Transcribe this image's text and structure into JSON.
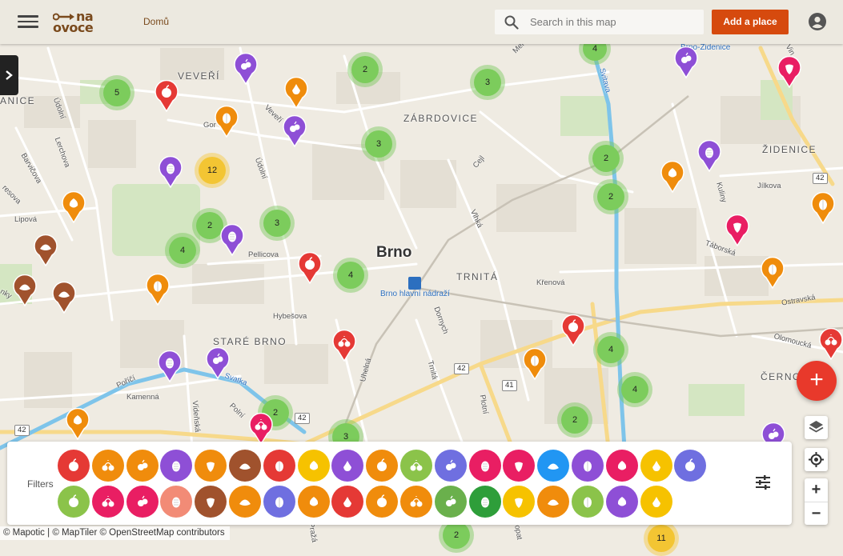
{
  "header": {
    "logo_line1": "na",
    "logo_line2": "ovoce",
    "home_label": "Domů",
    "search_placeholder": "Search in this map",
    "add_place_label": "Add a place"
  },
  "map": {
    "city_label": "Brno",
    "station_label": "Brno hlavní nádraží",
    "district_labels": [
      {
        "text": "VEVEŘÍ"
      },
      {
        "text": "ZÁBRDOVICE"
      },
      {
        "text": "ŽIDENICE"
      },
      {
        "text": "TRNITÁ"
      },
      {
        "text": "STARÉ BRNO"
      },
      {
        "text": "ČERNO"
      },
      {
        "text": "ANICE"
      }
    ],
    "street_labels": [
      {
        "text": "Údolní"
      },
      {
        "text": "Lerchova"
      },
      {
        "text": "Barvičova"
      },
      {
        "text": "Lipová"
      },
      {
        "text": "Veveří"
      },
      {
        "text": "Údolní"
      },
      {
        "text": "Pellicova"
      },
      {
        "text": "Hybešova"
      },
      {
        "text": "Kamenná"
      },
      {
        "text": "Poříčí"
      },
      {
        "text": "Vídeňská"
      },
      {
        "text": "Polní"
      },
      {
        "text": "Uhelná"
      },
      {
        "text": "Dornych"
      },
      {
        "text": "Trnitá"
      },
      {
        "text": "Plotní"
      },
      {
        "text": "Vlhká"
      },
      {
        "text": "Cejl"
      },
      {
        "text": "Křenová"
      },
      {
        "text": "Táborská"
      },
      {
        "text": "Jílkova"
      },
      {
        "text": "Ostravská"
      },
      {
        "text": "Olomoucká"
      },
      {
        "text": "Svitava"
      },
      {
        "text": "Brno-Židenice"
      },
      {
        "text": "Kuliny"
      },
      {
        "text": "Svatka"
      },
      {
        "text": "Gor"
      },
      {
        "text": "resova"
      },
      {
        "text": "nky"
      },
      {
        "text": "Mer"
      },
      {
        "text": "Vin"
      },
      {
        "text": "Pražá"
      },
      {
        "text": "opat"
      }
    ],
    "road_numbers": [
      "42",
      "42",
      "41",
      "42",
      "42"
    ],
    "clusters": [
      {
        "count": "5",
        "color": "#7ccc5c"
      },
      {
        "count": "2",
        "color": "#7ccc5c"
      },
      {
        "count": "3",
        "color": "#7ccc5c"
      },
      {
        "count": "4",
        "color": "#7ccc5c"
      },
      {
        "count": "3",
        "color": "#7ccc5c"
      },
      {
        "count": "12",
        "color": "#f3c533"
      },
      {
        "count": "2",
        "color": "#7ccc5c"
      },
      {
        "count": "2",
        "color": "#7ccc5c"
      },
      {
        "count": "2",
        "color": "#7ccc5c"
      },
      {
        "count": "3",
        "color": "#7ccc5c"
      },
      {
        "count": "4",
        "color": "#7ccc5c"
      },
      {
        "count": "4",
        "color": "#7ccc5c"
      },
      {
        "count": "4",
        "color": "#7ccc5c"
      },
      {
        "count": "4",
        "color": "#7ccc5c"
      },
      {
        "count": "2",
        "color": "#7ccc5c"
      },
      {
        "count": "2",
        "color": "#7ccc5c"
      },
      {
        "count": "3",
        "color": "#7ccc5c"
      },
      {
        "count": "2",
        "color": "#7ccc5c"
      },
      {
        "count": "11",
        "color": "#f3c533"
      }
    ],
    "pins": [
      {
        "color": "#e53935",
        "icon": "apple-icon"
      },
      {
        "color": "#8e4fd6",
        "icon": "plum-icon"
      },
      {
        "color": "#ef8c0c",
        "icon": "pear-icon"
      },
      {
        "color": "#ef8c0c",
        "icon": "walnut-icon"
      },
      {
        "color": "#8e4fd6",
        "icon": "plum-icon"
      },
      {
        "color": "#8e4fd6",
        "icon": "grape-icon"
      },
      {
        "color": "#ef8c0c",
        "icon": "apricot-icon"
      },
      {
        "color": "#8e4fd6",
        "icon": "grape-icon"
      },
      {
        "color": "#a0522d",
        "icon": "chestnut-icon"
      },
      {
        "color": "#a0522d",
        "icon": "chestnut-icon"
      },
      {
        "color": "#a0522d",
        "icon": "chestnut-icon"
      },
      {
        "color": "#ef8c0c",
        "icon": "walnut-icon"
      },
      {
        "color": "#e53935",
        "icon": "apple-icon"
      },
      {
        "color": "#e53935",
        "icon": "cherry-icon"
      },
      {
        "color": "#8e4fd6",
        "icon": "grape-icon"
      },
      {
        "color": "#8e4fd6",
        "icon": "plum-icon"
      },
      {
        "color": "#ef8c0c",
        "icon": "apricot-icon"
      },
      {
        "color": "#e91e63",
        "icon": "cherry-icon"
      },
      {
        "color": "#e53935",
        "icon": "apple-icon"
      },
      {
        "color": "#ef8c0c",
        "icon": "walnut-icon"
      },
      {
        "color": "#8e4fd6",
        "icon": "grape-icon"
      },
      {
        "color": "#8e4fd6",
        "icon": "plum-icon"
      },
      {
        "color": "#e91e63",
        "icon": "strawberry-icon"
      },
      {
        "color": "#ef8c0c",
        "icon": "apricot-icon"
      },
      {
        "color": "#e91e63",
        "icon": "strawberry-icon"
      },
      {
        "color": "#ef8c0c",
        "icon": "walnut-icon"
      },
      {
        "color": "#ef8c0c",
        "icon": "walnut-icon"
      },
      {
        "color": "#e53935",
        "icon": "cherry-icon"
      },
      {
        "color": "#8e4fd6",
        "icon": "plum-icon"
      }
    ]
  },
  "filters": {
    "label": "Filters",
    "row1": [
      {
        "name": "apple",
        "color": "#e53935"
      },
      {
        "name": "apricot",
        "color": "#f08c0c"
      },
      {
        "name": "walnut",
        "color": "#f08c0c"
      },
      {
        "name": "grape",
        "color": "#8e4fd6"
      },
      {
        "name": "hazelnut",
        "color": "#f08c0c"
      },
      {
        "name": "chestnut",
        "color": "#a0522d"
      },
      {
        "name": "cherry",
        "color": "#e53935"
      },
      {
        "name": "peach",
        "color": "#f6c200"
      },
      {
        "name": "blackberry",
        "color": "#8e4fd6"
      },
      {
        "name": "sour-cherry",
        "color": "#f08c0c"
      },
      {
        "name": "pear",
        "color": "#8bc34a"
      },
      {
        "name": "plum",
        "color": "#6f6fe0"
      },
      {
        "name": "raspberry",
        "color": "#e91e63"
      },
      {
        "name": "strawberry",
        "color": "#e91e63"
      },
      {
        "name": "blueberry",
        "color": "#2196f3"
      },
      {
        "name": "elderberry",
        "color": "#8e4fd6"
      },
      {
        "name": "mulberry",
        "color": "#e91e63"
      },
      {
        "name": "lemon",
        "color": "#f6c200"
      },
      {
        "name": "sloe",
        "color": "#6f6fe0"
      }
    ],
    "row2": [
      {
        "name": "gooseberry",
        "color": "#8bc34a"
      },
      {
        "name": "red-cherry",
        "color": "#e91e63"
      },
      {
        "name": "rosehip",
        "color": "#e91e63"
      },
      {
        "name": "wild-strawberry",
        "color": "#f28b76"
      },
      {
        "name": "medlar",
        "color": "#a0522d"
      },
      {
        "name": "rowan",
        "color": "#f08c0c"
      },
      {
        "name": "blackthorn",
        "color": "#6f6fe0"
      },
      {
        "name": "hawthorn",
        "color": "#f08c0c"
      },
      {
        "name": "currant",
        "color": "#e53935"
      },
      {
        "name": "pine-cone",
        "color": "#f08c0c"
      },
      {
        "name": "quince",
        "color": "#f08c0c"
      },
      {
        "name": "herb",
        "color": "#6ab04c"
      },
      {
        "name": "tree-leaf",
        "color": "#2e9e3a"
      },
      {
        "name": "lemon-2",
        "color": "#f6c200"
      },
      {
        "name": "sea-buckthorn",
        "color": "#f08c0c"
      },
      {
        "name": "tree",
        "color": "#8bc34a"
      },
      {
        "name": "aronia",
        "color": "#8e4fd6"
      },
      {
        "name": "yellow-plum",
        "color": "#f6c200"
      }
    ]
  },
  "attribution": "© Mapotic | © MapTiler © OpenStreetMap contributors"
}
